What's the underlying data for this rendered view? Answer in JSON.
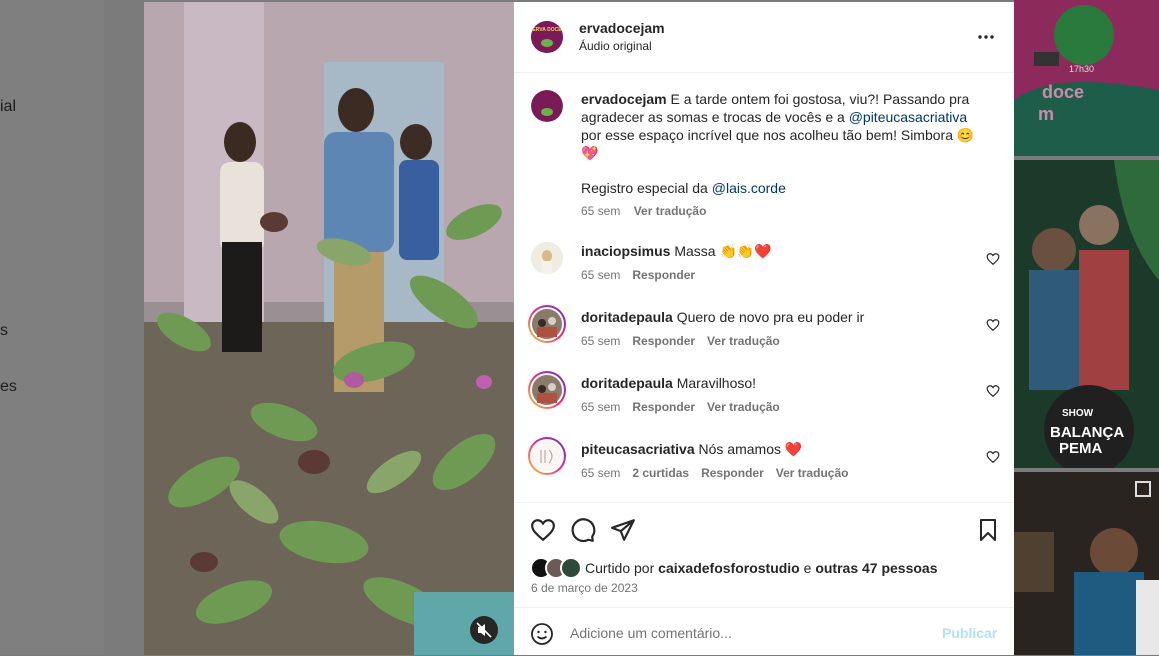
{
  "background": {
    "nav_fragments": [
      "ial",
      "s",
      "es"
    ],
    "thumb_caption_1": "doce",
    "thumb_caption_1b": "m",
    "thumb_time": "17h30",
    "thumb_show": "SHOW",
    "thumb_title_1": "BALANÇA",
    "thumb_title_2": "PEMA"
  },
  "post": {
    "author": "ervadocejam",
    "audio": "Áudio original",
    "avatar_text": "ERVA DOCE",
    "caption": {
      "username": "ervadocejam",
      "text_1": " E a tarde ontem foi gostosa, viu?! Passando pra agradecer as somas e trocas de vocês e a ",
      "mention_1": "@piteucasacriativa",
      "text_2": " por esse espaço incrível que nos acolheu tão bem! Simbora ",
      "emoji_1": "😊💖",
      "text_3": "Registro especial da ",
      "mention_2": "@lais.corde",
      "time": "65 sem",
      "translate": "Ver tradução"
    },
    "comments": [
      {
        "username": "inaciopsimus",
        "text": "Massa 👏👏❤️",
        "time": "65 sem",
        "actions": [
          "Responder"
        ]
      },
      {
        "username": "doritadepaula",
        "text": "Quero de novo pra eu poder ir",
        "time": "65 sem",
        "actions": [
          "Responder",
          "Ver tradução"
        ]
      },
      {
        "username": "doritadepaula",
        "text": "Maravilhoso!",
        "time": "65 sem",
        "actions": [
          "Responder",
          "Ver tradução"
        ]
      },
      {
        "username": "piteucasacriativa",
        "text": "Nós amamos ❤️",
        "time": "65 sem",
        "actions": [
          "2 curtidas",
          "Responder",
          "Ver tradução"
        ]
      }
    ],
    "likes": {
      "prefix": "Curtido por ",
      "user": "caixadefosforostudio",
      "middle": " e ",
      "others": "outras 47 pessoas"
    },
    "date": "6 de março de 2023",
    "comment_placeholder": "Adicione um comentário...",
    "publish_label": "Publicar"
  },
  "colors": {
    "link": "#00376b",
    "muted": "#737373",
    "publish": "#b2dffc",
    "story_ring_start": "#f9ce34",
    "story_ring_mid": "#ee2a7b",
    "story_ring_end": "#6228d7"
  },
  "icons": [
    "more-icon",
    "heart-icon",
    "comment-icon",
    "share-icon",
    "save-icon",
    "emoji-icon",
    "mute-icon"
  ]
}
